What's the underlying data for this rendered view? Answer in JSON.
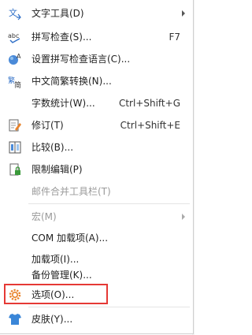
{
  "menu": {
    "items": [
      {
        "label": "文字工具(D)",
        "icon": "text-tool-icon",
        "submenu": true
      },
      {
        "label": "拼写检查(S)...",
        "shortcut": "F7",
        "icon": "spellcheck-abc-icon"
      },
      {
        "label": "设置拼写检查语言(C)...",
        "icon": "language-globe-icon"
      },
      {
        "label": "中文简繁转换(N)...",
        "icon": "chinese-convert-icon"
      },
      {
        "label": "字数统计(W)...",
        "shortcut": "Ctrl+Shift+G"
      },
      {
        "label": "修订(T)",
        "shortcut": "Ctrl+Shift+E",
        "icon": "track-changes-icon"
      },
      {
        "label": "比较(B)...",
        "icon": "compare-icon"
      },
      {
        "label": "限制编辑(P)",
        "icon": "lock-icon"
      },
      {
        "label": "邮件合并工具栏(T)",
        "disabled": true
      },
      {
        "label": "宏(M)",
        "disabled": true,
        "submenu": true
      },
      {
        "label": "COM 加载项(A)..."
      },
      {
        "label": "加载项(I)..."
      },
      {
        "label": "备份管理(K)..."
      },
      {
        "label": "选项(O)...",
        "icon": "gear-icon",
        "highlighted": true
      },
      {
        "label": "皮肤(Y)...",
        "icon": "shirt-icon"
      }
    ]
  },
  "colors": {
    "highlight_border": "#e53935",
    "disabled_text": "#9a9a9a",
    "icon_blue": "#2f6fc7",
    "icon_orange": "#e8822a"
  }
}
